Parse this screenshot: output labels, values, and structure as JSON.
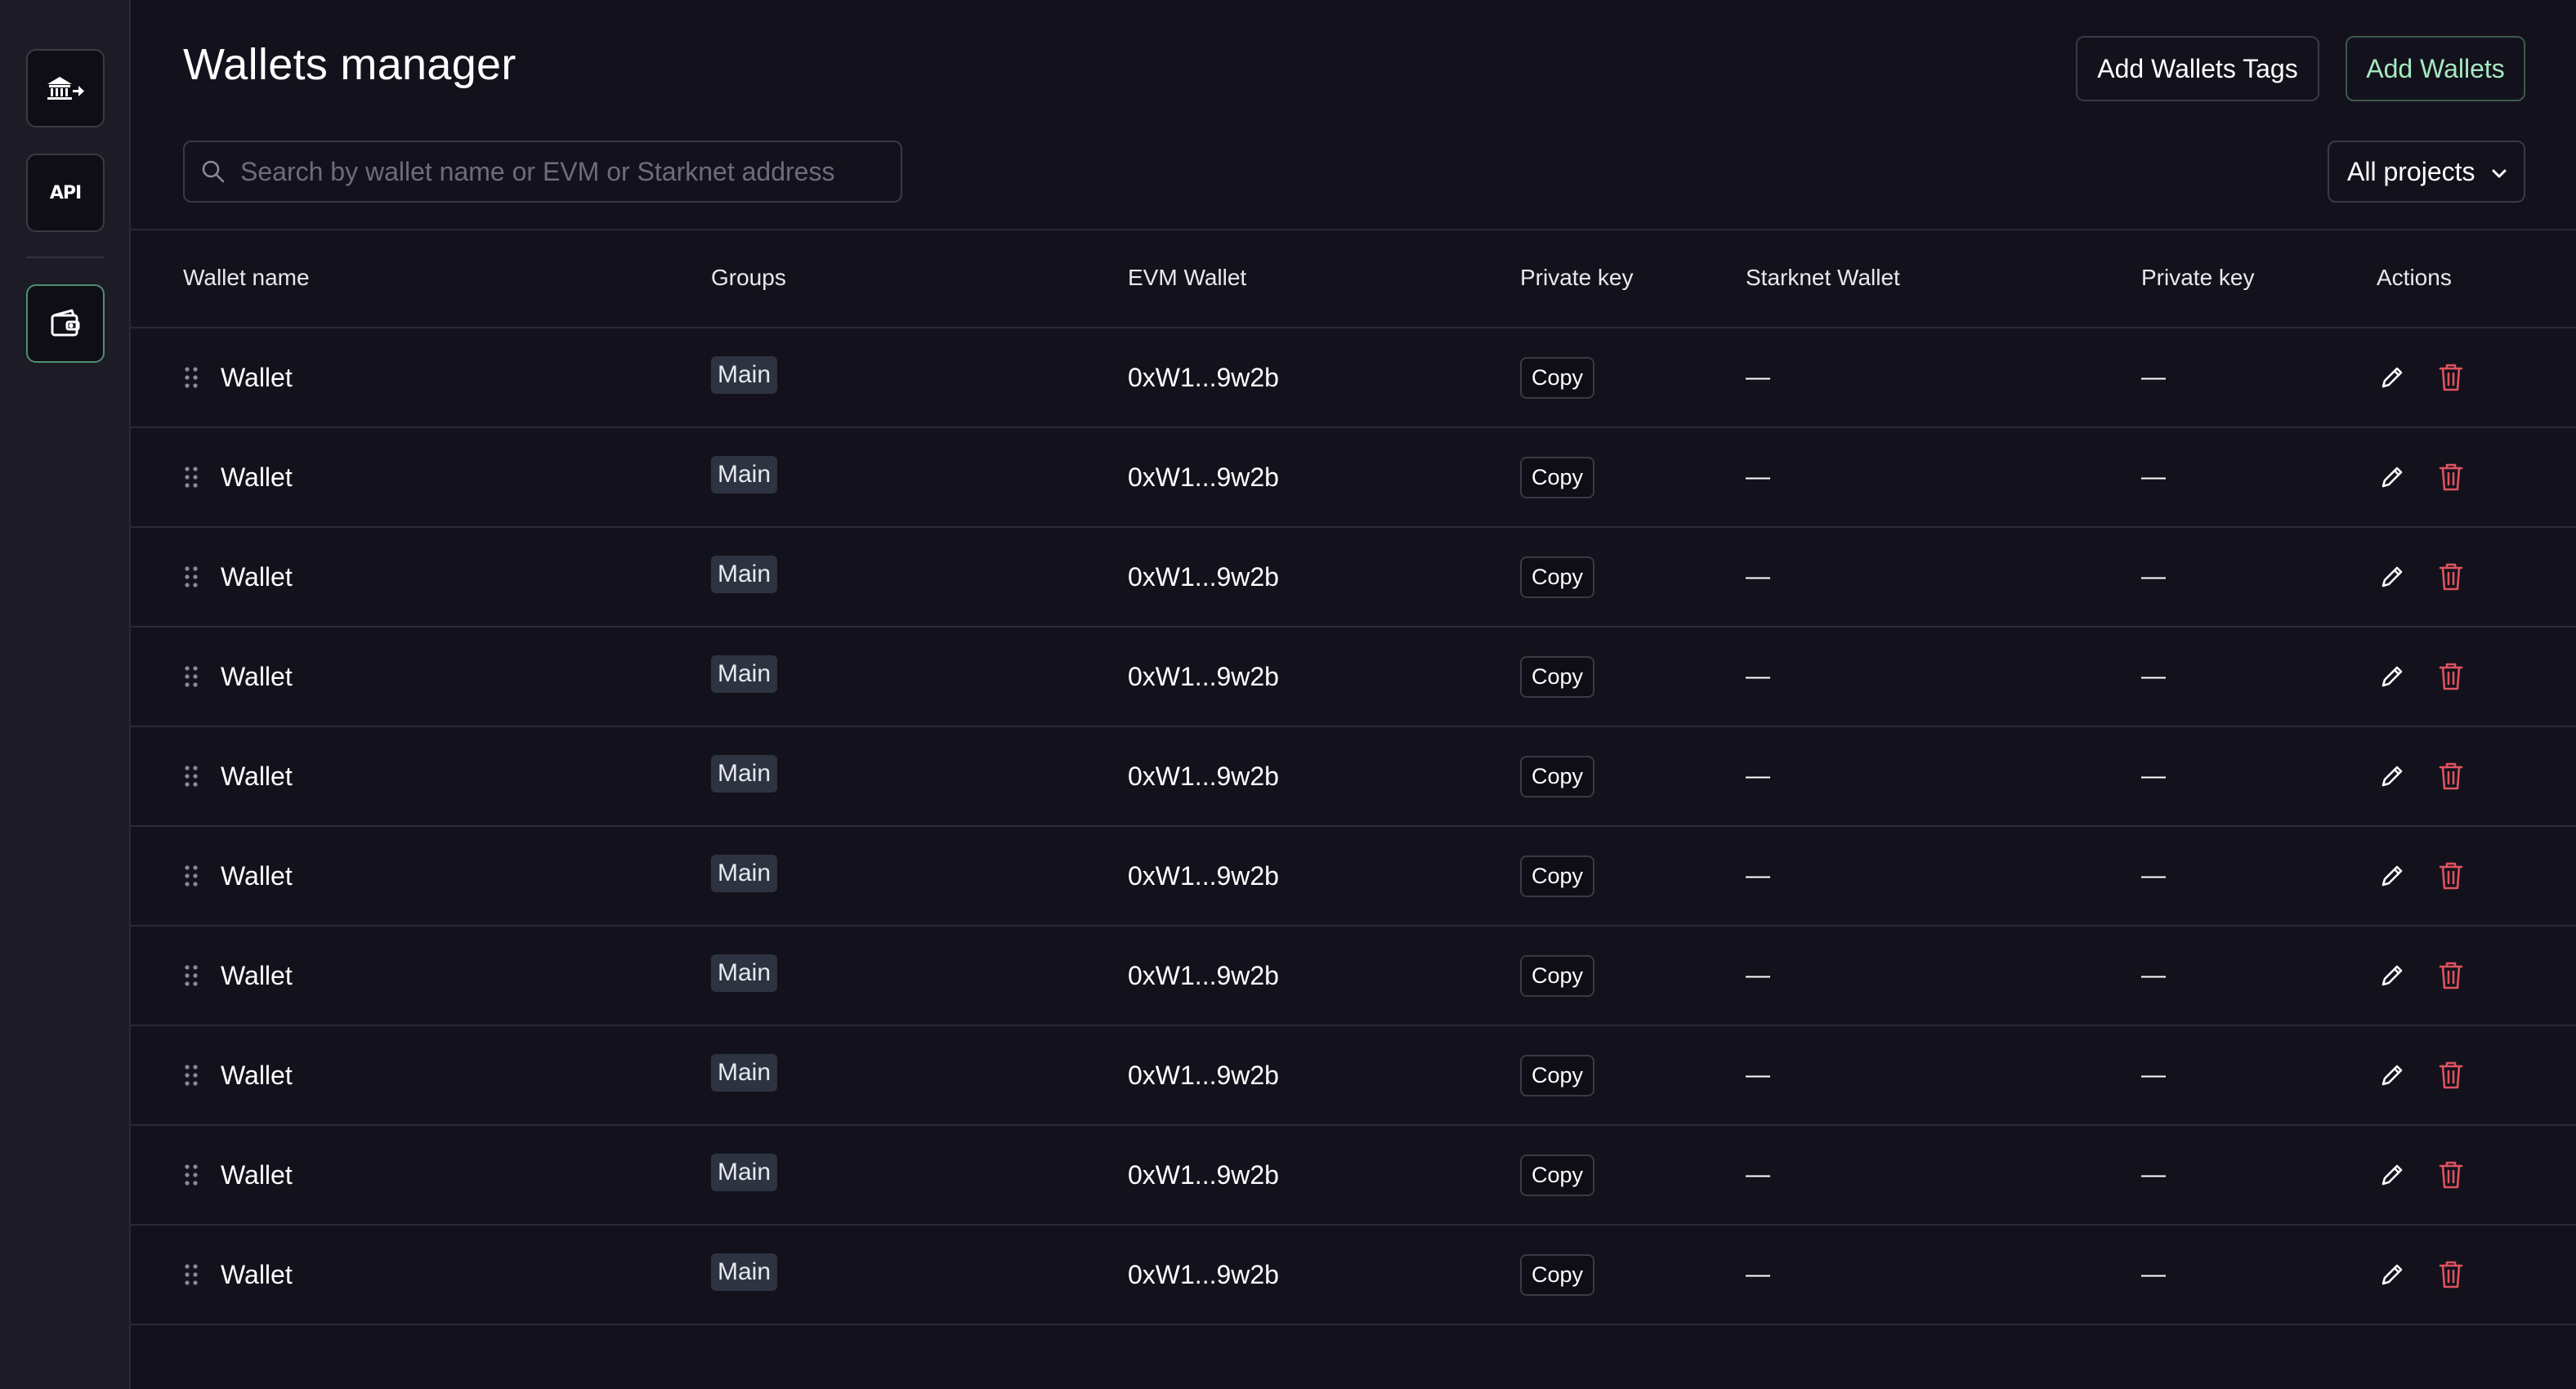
{
  "header": {
    "title": "Wallets manager",
    "add_tags_label": "Add Wallets Tags",
    "add_wallets_label": "Add Wallets"
  },
  "sidebar": {
    "items": [
      {
        "name": "bank-transfer",
        "icon": "bank-arrow-icon"
      },
      {
        "name": "api",
        "label": "API"
      },
      {
        "name": "wallets",
        "icon": "wallet-icon",
        "active": true
      }
    ]
  },
  "search": {
    "placeholder": "Search by wallet name or EVM or Starknet address",
    "value": ""
  },
  "projects_filter": {
    "selected": "All projects"
  },
  "table": {
    "columns": [
      "Wallet name",
      "Groups",
      "EVM Wallet",
      "Private key",
      "Starknet Wallet",
      "Private key",
      "Actions"
    ],
    "rows": [
      {
        "name": "Wallet",
        "group": "Main",
        "evm": "0xW1...9w2b",
        "pk": "Copy",
        "starknet": "—",
        "starknet_pk": "—"
      },
      {
        "name": "Wallet",
        "group": "Main",
        "evm": "0xW1...9w2b",
        "pk": "Copy",
        "starknet": "—",
        "starknet_pk": "—"
      },
      {
        "name": "Wallet",
        "group": "Main",
        "evm": "0xW1...9w2b",
        "pk": "Copy",
        "starknet": "—",
        "starknet_pk": "—"
      },
      {
        "name": "Wallet",
        "group": "Main",
        "evm": "0xW1...9w2b",
        "pk": "Copy",
        "starknet": "—",
        "starknet_pk": "—"
      },
      {
        "name": "Wallet",
        "group": "Main",
        "evm": "0xW1...9w2b",
        "pk": "Copy",
        "starknet": "—",
        "starknet_pk": "—"
      },
      {
        "name": "Wallet",
        "group": "Main",
        "evm": "0xW1...9w2b",
        "pk": "Copy",
        "starknet": "—",
        "starknet_pk": "—"
      },
      {
        "name": "Wallet",
        "group": "Main",
        "evm": "0xW1...9w2b",
        "pk": "Copy",
        "starknet": "—",
        "starknet_pk": "—"
      },
      {
        "name": "Wallet",
        "group": "Main",
        "evm": "0xW1...9w2b",
        "pk": "Copy",
        "starknet": "—",
        "starknet_pk": "—"
      },
      {
        "name": "Wallet",
        "group": "Main",
        "evm": "0xW1...9w2b",
        "pk": "Copy",
        "starknet": "—",
        "starknet_pk": "—"
      },
      {
        "name": "Wallet",
        "group": "Main",
        "evm": "0xW1...9w2b",
        "pk": "Copy",
        "starknet": "—",
        "starknet_pk": "—"
      }
    ]
  },
  "colors": {
    "background": "#13121c",
    "sidebar": "#1d1c26",
    "accent_green": "#a5e9c0",
    "delete_red": "#e0525f",
    "tag_bg": "#2d3340"
  }
}
